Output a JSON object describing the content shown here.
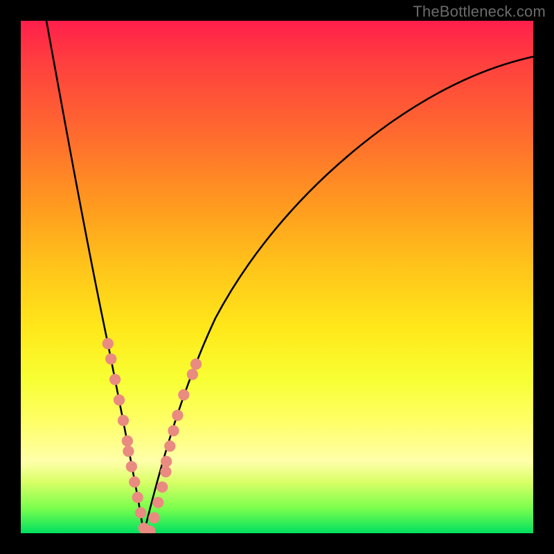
{
  "watermark": {
    "text": "TheBottleneck.com"
  },
  "chart_data": {
    "type": "line",
    "title": "",
    "xlabel": "",
    "ylabel": "",
    "xlim": [
      0,
      100
    ],
    "ylim": [
      0,
      100
    ],
    "notes": "Two asymmetric descending/ascending curves forming a V around x≈24; vertical rainbow gradient background (red top → green bottom); salmon dot clusters near the V on both branches; no axis ticks, labels, grid, or legend visible.",
    "series": [
      {
        "name": "left-branch",
        "x": [
          5,
          7,
          9,
          11,
          13,
          15,
          17,
          19,
          20,
          21,
          22,
          23,
          24
        ],
        "y": [
          100,
          89,
          78,
          67,
          56,
          46,
          37,
          27,
          22,
          17,
          12,
          6,
          0
        ]
      },
      {
        "name": "right-branch",
        "x": [
          24,
          26,
          28,
          31,
          35,
          40,
          46,
          53,
          61,
          70,
          80,
          90,
          100
        ],
        "y": [
          0,
          8,
          15,
          24,
          34,
          44,
          54,
          63,
          71,
          78,
          84,
          89,
          93
        ]
      }
    ],
    "marker_clusters": [
      {
        "name": "left-cluster",
        "color": "#e98b80",
        "points": [
          {
            "x": 17.0,
            "y": 37
          },
          {
            "x": 17.6,
            "y": 34
          },
          {
            "x": 18.4,
            "y": 30
          },
          {
            "x": 19.2,
            "y": 26
          },
          {
            "x": 20.0,
            "y": 22
          },
          {
            "x": 20.8,
            "y": 18
          },
          {
            "x": 21.0,
            "y": 16
          },
          {
            "x": 21.6,
            "y": 13
          },
          {
            "x": 22.2,
            "y": 10
          },
          {
            "x": 22.8,
            "y": 7
          },
          {
            "x": 23.4,
            "y": 4
          },
          {
            "x": 24.0,
            "y": 1
          },
          {
            "x": 24.6,
            "y": 0.5
          },
          {
            "x": 25.2,
            "y": 0.4
          }
        ]
      },
      {
        "name": "right-cluster",
        "color": "#e98b80",
        "points": [
          {
            "x": 26.0,
            "y": 3
          },
          {
            "x": 26.8,
            "y": 6
          },
          {
            "x": 27.6,
            "y": 9
          },
          {
            "x": 28.3,
            "y": 12
          },
          {
            "x": 28.4,
            "y": 14
          },
          {
            "x": 29.1,
            "y": 17
          },
          {
            "x": 29.8,
            "y": 20
          },
          {
            "x": 30.6,
            "y": 23
          },
          {
            "x": 31.8,
            "y": 27
          },
          {
            "x": 33.5,
            "y": 31
          },
          {
            "x": 34.2,
            "y": 33
          }
        ]
      }
    ],
    "gradient_stops": [
      {
        "pos": 0.0,
        "color": "#ff1f4b"
      },
      {
        "pos": 0.3,
        "color": "#ff8a20"
      },
      {
        "pos": 0.6,
        "color": "#ffe81a"
      },
      {
        "pos": 0.86,
        "color": "#ffffaa"
      },
      {
        "pos": 1.0,
        "color": "#00e060"
      }
    ]
  }
}
